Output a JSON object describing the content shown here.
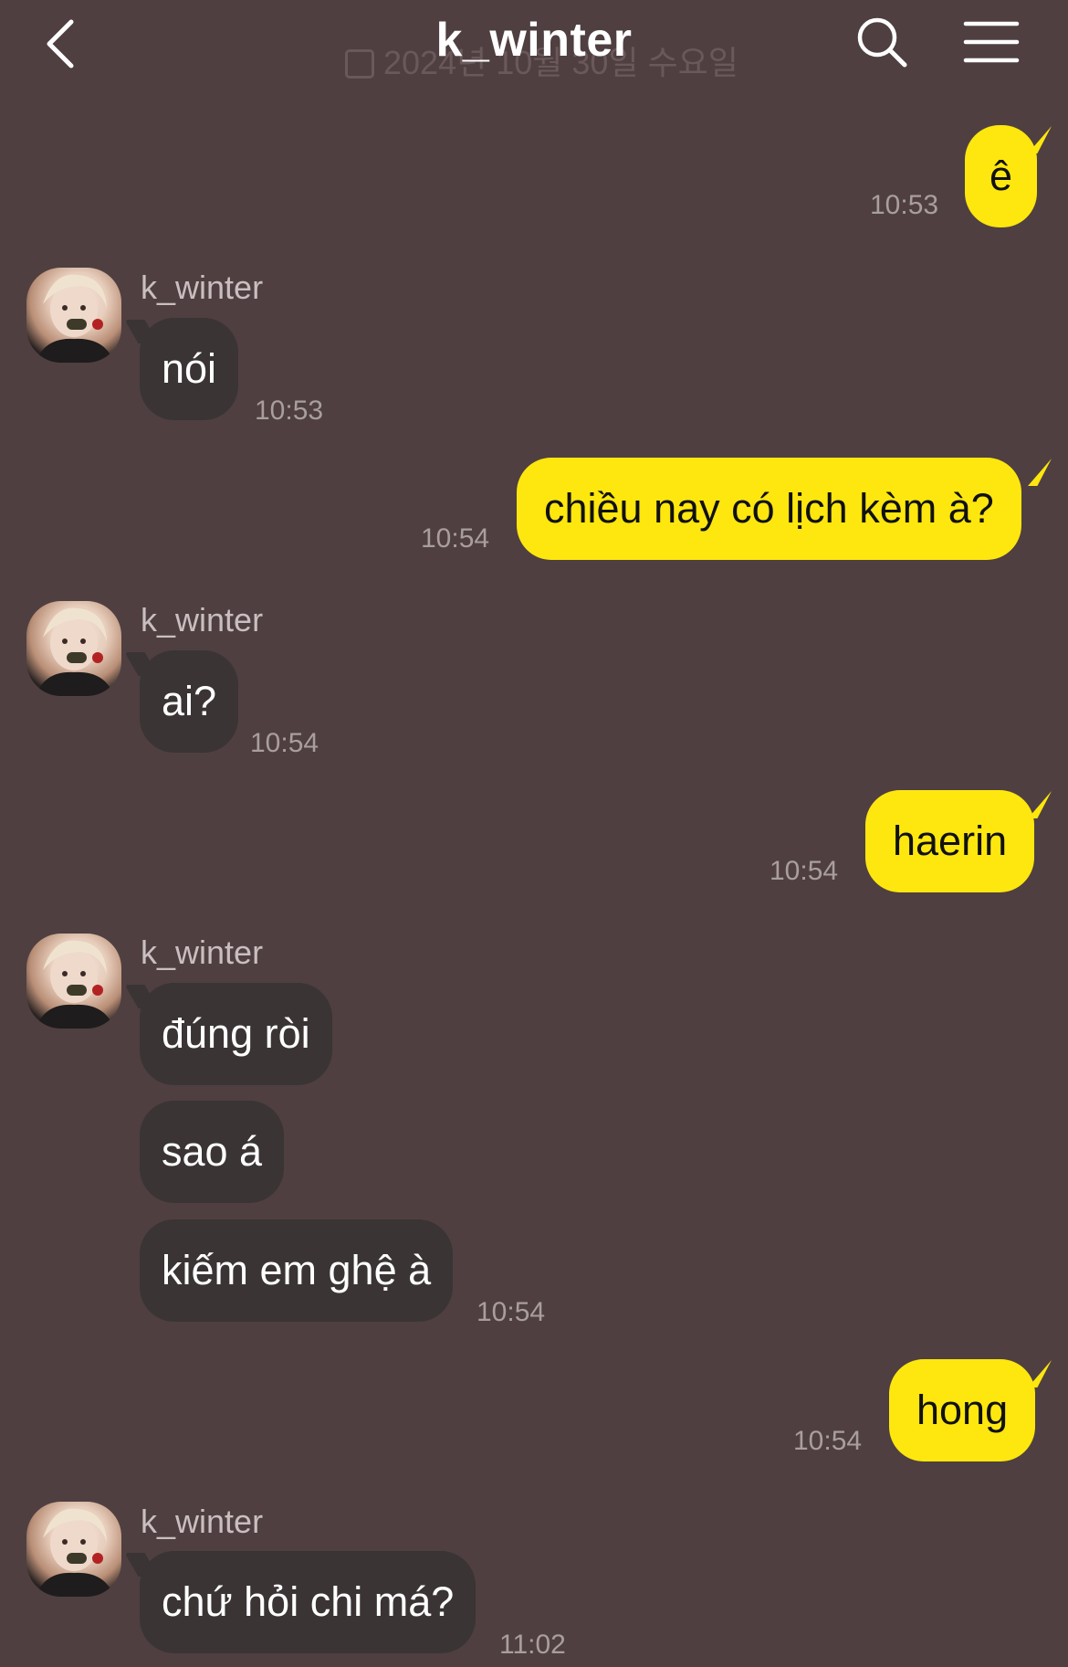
{
  "header": {
    "title": "k_winter",
    "date_ghost": "2024년 10월 30일 수요일",
    "back_icon": "chevron-left-icon",
    "search_icon": "search-icon",
    "menu_icon": "hamburger-menu-icon"
  },
  "colors": {
    "background": "#4f3f41",
    "incoming_bubble": "#3a3435",
    "outgoing_bubble": "#fde70e",
    "timestamp": "#a99e9f"
  },
  "messages": [
    {
      "direction": "out",
      "text": "ê",
      "time": "10:53"
    },
    {
      "direction": "in",
      "sender": "k_winter",
      "text": "nói",
      "time": "10:53"
    },
    {
      "direction": "out",
      "text": "chiều nay có lịch kèm à?",
      "time": "10:54"
    },
    {
      "direction": "in",
      "sender": "k_winter",
      "text": "ai?",
      "time": "10:54"
    },
    {
      "direction": "out",
      "text": "haerin",
      "time": "10:54"
    },
    {
      "direction": "in",
      "sender": "k_winter",
      "text": "đúng ròi"
    },
    {
      "direction": "in",
      "text": "sao á"
    },
    {
      "direction": "in",
      "text": "kiếm em ghệ à",
      "time": "10:54"
    },
    {
      "direction": "out",
      "text": "hong",
      "time": "10:54"
    },
    {
      "direction": "in",
      "sender": "k_winter",
      "text": "chứ hỏi chi má?",
      "time": "11:02"
    }
  ]
}
